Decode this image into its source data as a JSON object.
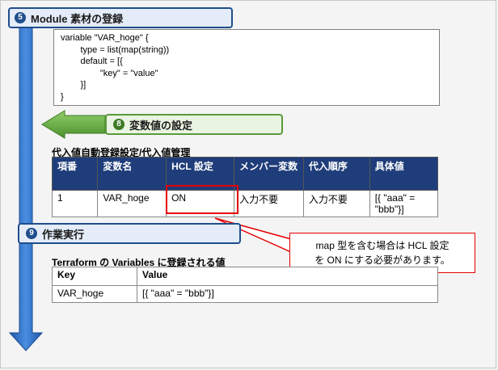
{
  "steps": {
    "step5": {
      "num": "5",
      "label": "Module 素材の登録"
    },
    "step8": {
      "num": "8",
      "label": "変数値の設定"
    },
    "step9": {
      "num": "9",
      "label": "作業実行"
    }
  },
  "code": {
    "lines": [
      "variable \"VAR_hoge\" {",
      "        type = list(map(string))",
      "        default = [{",
      "                \"key\" = \"value\"",
      "        }]",
      "}"
    ]
  },
  "table1": {
    "title": "代入値自動登録設定/代入値管理",
    "headers": [
      "項番",
      "変数名",
      "HCL 設定",
      "メンバー変数",
      "代入順序",
      "具体値"
    ],
    "row": [
      "1",
      "VAR_hoge",
      "ON",
      "入力不要",
      "入力不要",
      "[{ \"aaa\" = \"bbb\"}]"
    ]
  },
  "table2": {
    "title": "Terraform の Variables に登録される値",
    "headers": [
      "Key",
      "Value"
    ],
    "row": [
      "VAR_hoge",
      "[{ \"aaa\" = \"bbb\"}]"
    ]
  },
  "callout": {
    "line1": "map 型を含む場合は HCL 設定",
    "line2": "を ON にする必要があります。"
  },
  "colors": {
    "blue_arrow": "#2e6fc3",
    "green_arrow": "#6aa84f",
    "header_bg": "#1f3d7a",
    "highlight": "#e60000"
  }
}
